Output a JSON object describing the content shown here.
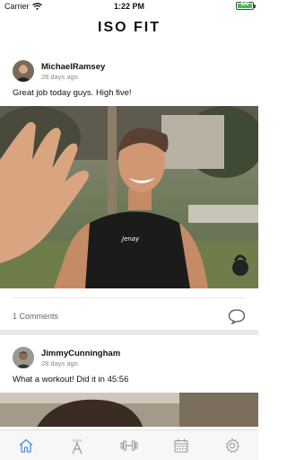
{
  "status": {
    "carrier": "Carrier",
    "time": "1:22 PM",
    "battery_label": "EN"
  },
  "app": {
    "title": "ISO FIT"
  },
  "posts": [
    {
      "user": "MichaelRamsey",
      "time": "28 days ago",
      "text": "Great job today guys. High five!",
      "comments_label": "1 Comments"
    },
    {
      "user": "JimmyCunningham",
      "time": "28 days ago",
      "text": "What a workout! Did it in 45:56"
    }
  ],
  "tabs": [
    {
      "icon": "home-icon",
      "active": true
    },
    {
      "icon": "gym-icon",
      "active": false
    },
    {
      "icon": "dumbbell-icon",
      "active": false
    },
    {
      "icon": "calendar-icon",
      "active": false
    },
    {
      "icon": "settings-icon",
      "active": false
    }
  ],
  "colors": {
    "accent": "#4a90e2",
    "battery": "#3fbf4f",
    "icon_gray": "#9a9a9a"
  }
}
